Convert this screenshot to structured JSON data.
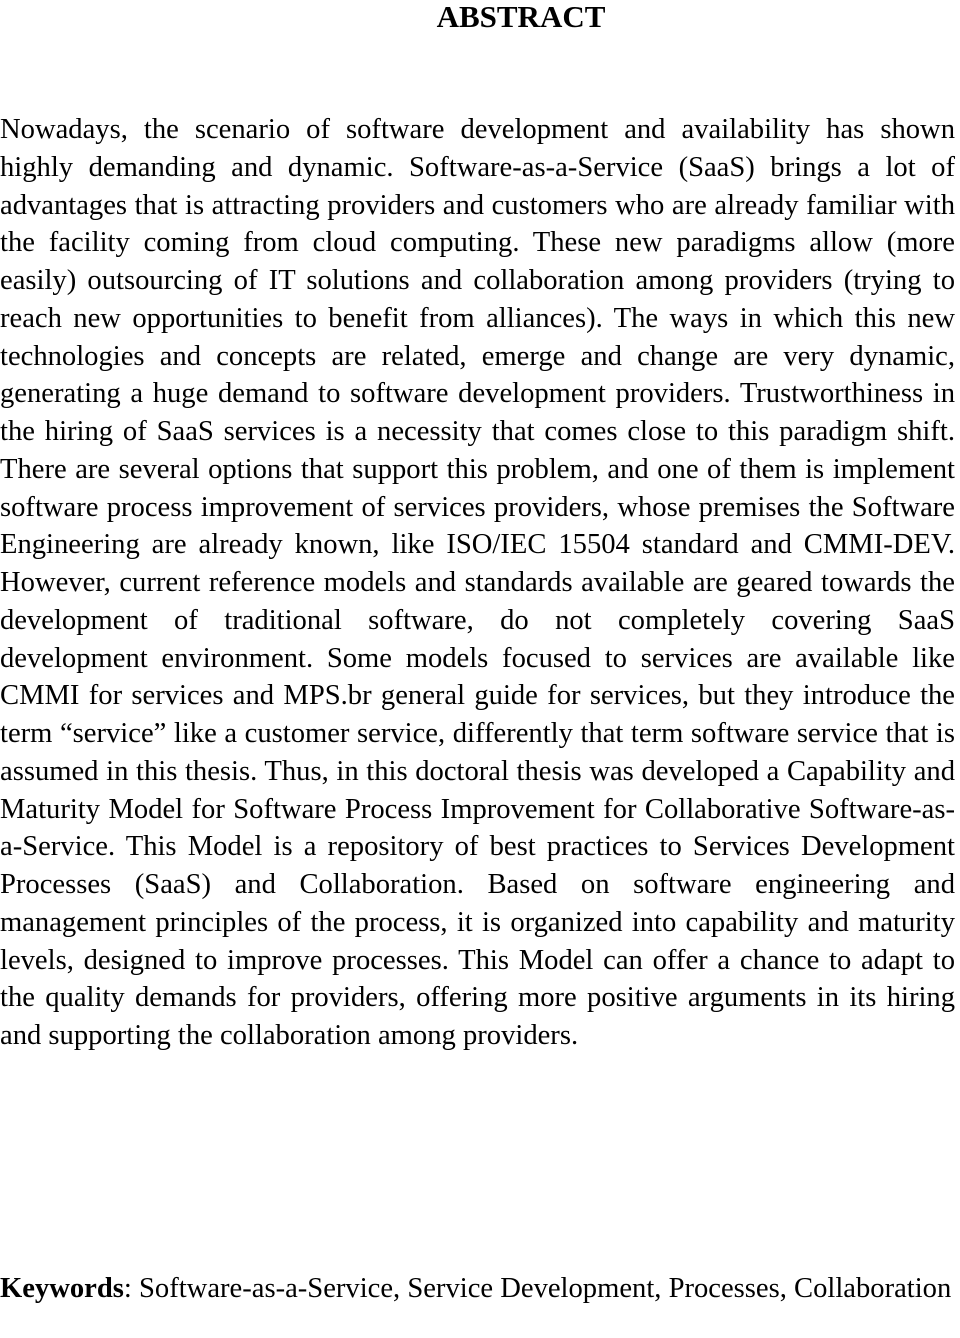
{
  "title": "ABSTRACT",
  "abstract": "Nowadays, the scenario of software development and availability has shown highly demanding and dynamic. Software-as-a-Service (SaaS) brings a lot of advantages that is attracting providers and customers who are already familiar with the facility coming from cloud computing. These new paradigms allow (more easily) outsourcing of IT solutions and collaboration among providers (trying to reach new opportunities to benefit from alliances). The ways in which this new technologies and concepts are related, emerge and change are very dynamic, generating a huge demand to software development providers. Trustworthiness in the hiring of SaaS services is a necessity that comes close to this paradigm shift. There are several options that support this problem, and one of them is implement software process improvement of services providers, whose premises the Software Engineering are already known, like ISO/IEC 15504 standard and CMMI-DEV. However, current reference models and standards available are geared towards the development of traditional software, do not completely covering SaaS development environment. Some models focused to services are available like CMMI for services and MPS.br general guide for services, but they introduce the term “service” like a customer service, differently that term software service that is assumed in this thesis. Thus, in this doctoral thesis was developed a Capability and Maturity Model for Software Process Improvement for Collaborative Software-as-a-Service. This Model is a repository of best practices to Services Development Processes (SaaS) and Collaboration. Based on software engineering and management principles of the process, it is organized into capability and maturity levels, designed to improve processes. This Model can offer a chance to adapt to the quality demands for providers, offering more positive arguments in its hiring and supporting the collaboration among providers.",
  "keywords": {
    "label": "Keywords",
    "separator": ":",
    "text": " Software-as-a-Service, Service Development, Processes, Collaboration"
  }
}
